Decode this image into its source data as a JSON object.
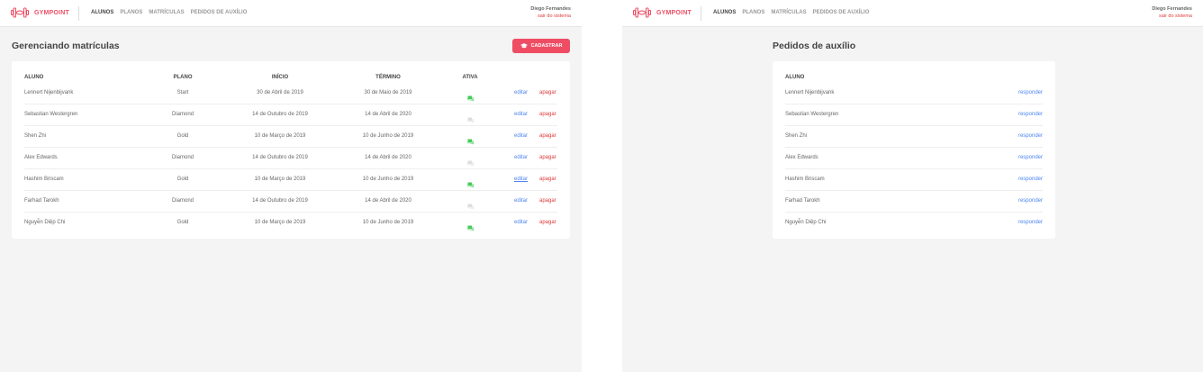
{
  "brand": {
    "name": "GYMPOINT",
    "color": "#ee4d64"
  },
  "nav": [
    {
      "label": "ALUNOS",
      "active": true
    },
    {
      "label": "PLANOS",
      "active": false
    },
    {
      "label": "MATRÍCULAS",
      "active": false
    },
    {
      "label": "PEDIDOS DE AUXÍLIO",
      "active": false
    }
  ],
  "user": {
    "name": "Diego Fernandes",
    "logout": "sair do sistema"
  },
  "enrollments": {
    "title": "Gerenciando matrículas",
    "register_button": "CADASTRAR",
    "columns": {
      "student": "ALUNO",
      "plan": "PLANO",
      "start": "INÍCIO",
      "end": "TÉRMINO",
      "active": "ATIVA"
    },
    "rows": [
      {
        "student": "Lennert Nijenbijvank",
        "plan": "Start",
        "start": "30 de Abril de 2019",
        "end": "30 de Maio de 2019",
        "active": true
      },
      {
        "student": "Sebastian Westergren",
        "plan": "Diamond",
        "start": "14 de Outubro de 2019",
        "end": "14 de Abril de 2020",
        "active": false
      },
      {
        "student": "Shen Zhi",
        "plan": "Gold",
        "start": "10 de Março de 2019",
        "end": "10 de Junho de 2019",
        "active": true
      },
      {
        "student": "Alex Edwards",
        "plan": "Diamond",
        "start": "14 de Outubro de 2019",
        "end": "14 de Abril de 2020",
        "active": false
      },
      {
        "student": "Hashim Briscam",
        "plan": "Gold",
        "start": "10 de Março de 2019",
        "end": "10 de Junho de 2019",
        "active": true,
        "edit_hovered": true
      },
      {
        "student": "Farhad Tarokh",
        "plan": "Diamond",
        "start": "14 de Outubro de 2019",
        "end": "14 de Abril de 2020",
        "active": false
      },
      {
        "student": "Nguyễn Diệp Chi",
        "plan": "Gold",
        "start": "10 de Março de 2019",
        "end": "10 de Junho de 2019",
        "active": true
      }
    ],
    "edit_label": "editar",
    "delete_label": "apagar"
  },
  "help_orders": {
    "title": "Pedidos de auxílio",
    "column_student": "ALUNO",
    "reply_label": "responder",
    "rows": [
      {
        "student": "Lennert Nijenbijvank"
      },
      {
        "student": "Sebastian Westergren"
      },
      {
        "student": "Shen Zhi"
      },
      {
        "student": "Alex Edwards"
      },
      {
        "student": "Hashim Briscam"
      },
      {
        "student": "Farhad Tarokh"
      },
      {
        "student": "Nguyễn Diệp Chi"
      }
    ]
  },
  "colors": {
    "active_icon": "#42cb59",
    "inactive_icon": "#dddddd",
    "link_blue": "#4d85ee",
    "link_red": "#de3b3b"
  }
}
